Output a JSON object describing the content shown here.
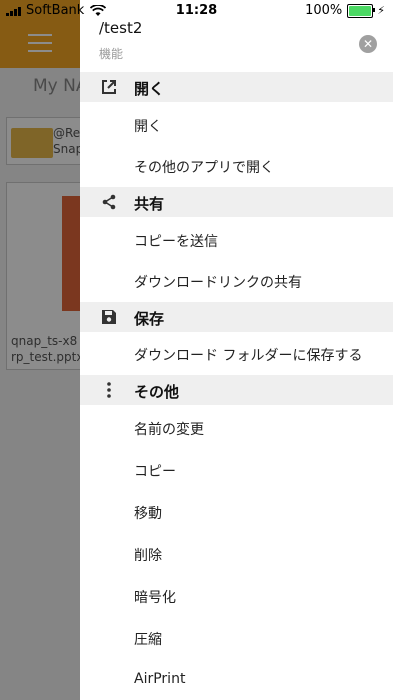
{
  "status_bar": {
    "carrier": "SoftBank",
    "time": "11:28",
    "battery": "100%"
  },
  "background": {
    "title": "My NA",
    "card1_line1": "@Re",
    "card1_line2": "Snap",
    "card2_line1": "qnap_ts-x8",
    "card2_line2": "rp_test.pptx"
  },
  "drawer": {
    "path": "/test2",
    "subtitle": "機能",
    "sections": {
      "open": {
        "title": "開く",
        "icon": "open-external-icon",
        "items": [
          "開く",
          "その他のアプリで開く"
        ]
      },
      "share": {
        "title": "共有",
        "icon": "share-icon",
        "items": [
          "コピーを送信",
          "ダウンロードリンクの共有"
        ]
      },
      "save": {
        "title": "保存",
        "icon": "save-icon",
        "items": [
          "ダウンロード フォルダーに保存する"
        ]
      },
      "other": {
        "title": "その他",
        "icon": "more-vertical-icon",
        "items": [
          "名前の変更",
          "コピー",
          "移動",
          "削除",
          "暗号化",
          "圧縮",
          "AirPrint"
        ]
      }
    }
  },
  "colors": {
    "accent": "#f5a623",
    "section_bg": "#efefef",
    "battery": "#4cd964"
  }
}
